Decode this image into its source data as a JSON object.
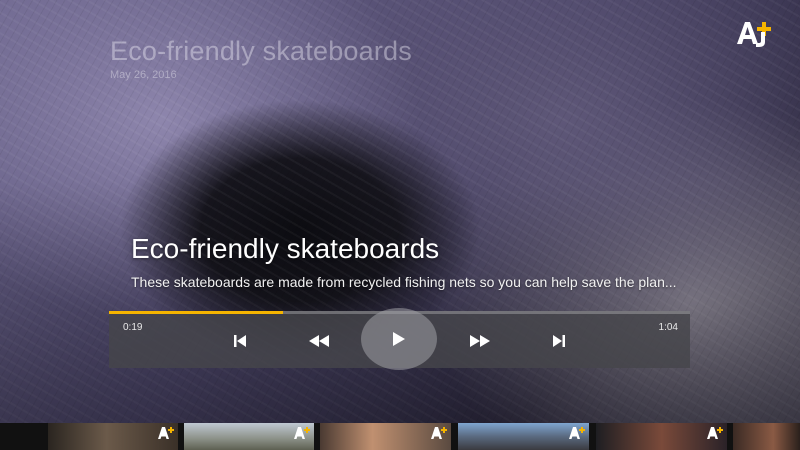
{
  "background_info": {
    "title": "Eco-friendly skateboards",
    "date": "May 26, 2016"
  },
  "brand": {
    "logo": "AJ+",
    "icon": "aj-plus-logo",
    "accent_color": "#f5b400"
  },
  "video": {
    "title": "Eco-friendly skateboards",
    "description": "These skateboards are made from recycled fishing nets so you can help save the plan..."
  },
  "player": {
    "current_time": "0:19",
    "duration": "1:04",
    "progress": 0.3,
    "controls": [
      {
        "name": "skip-previous",
        "icon": "skip-previous-icon"
      },
      {
        "name": "rewind",
        "icon": "rewind-icon"
      },
      {
        "name": "play",
        "icon": "play-icon"
      },
      {
        "name": "fast-forward",
        "icon": "fast-forward-icon"
      },
      {
        "name": "skip-next",
        "icon": "skip-next-icon"
      }
    ]
  },
  "thumbnails": [
    {
      "subject": "person portrait",
      "icon": "aj-plus-badge"
    },
    {
      "subject": "landscape",
      "icon": "aj-plus-badge"
    },
    {
      "subject": "people outdoors",
      "icon": "aj-plus-badge"
    },
    {
      "subject": "crowd",
      "icon": "aj-plus-badge"
    },
    {
      "subject": "person portrait",
      "icon": "aj-plus-badge"
    },
    {
      "subject": "person portrait",
      "icon": "none"
    }
  ]
}
